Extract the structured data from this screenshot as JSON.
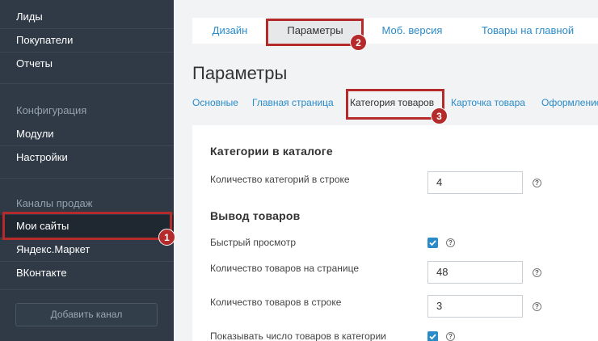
{
  "sidebar": {
    "items_top": [
      "Лиды",
      "Покупатели",
      "Отчеты"
    ],
    "config_section": "Конфигурация",
    "config_items": [
      "Модули",
      "Настройки"
    ],
    "channels_section": "Каналы продаж",
    "channel_items": [
      "Мои сайты",
      "Яндекс.Маркет",
      "ВКонтакте"
    ],
    "add_channel": "Добавить канал"
  },
  "top_tabs": [
    "Дизайн",
    "Параметры",
    "Моб. версия",
    "Товары на главной"
  ],
  "page_title": "Параметры",
  "sub_tabs": [
    "Основные",
    "Главная страница",
    "Категория товаров",
    "Карточка товара",
    "Оформление"
  ],
  "sections": {
    "catalog": {
      "title": "Категории в каталоге",
      "categories_per_row_label": "Количество категорий в строке",
      "categories_per_row_value": "4"
    },
    "products": {
      "title": "Вывод товаров",
      "quick_view_label": "Быстрый просмотр",
      "quick_view_checked": true,
      "per_page_label": "Количество товаров на странице",
      "per_page_value": "48",
      "per_row_label": "Количество товаров в строке",
      "per_row_value": "3",
      "show_count_label": "Показывать число товаров в категории",
      "show_count_checked": true
    }
  },
  "help_glyph": "?",
  "annotations": [
    "1",
    "2",
    "3"
  ],
  "colors": {
    "accent": "#2a8bc9",
    "sidebar": "#2f3a46",
    "highlight": "#b52a2a"
  }
}
